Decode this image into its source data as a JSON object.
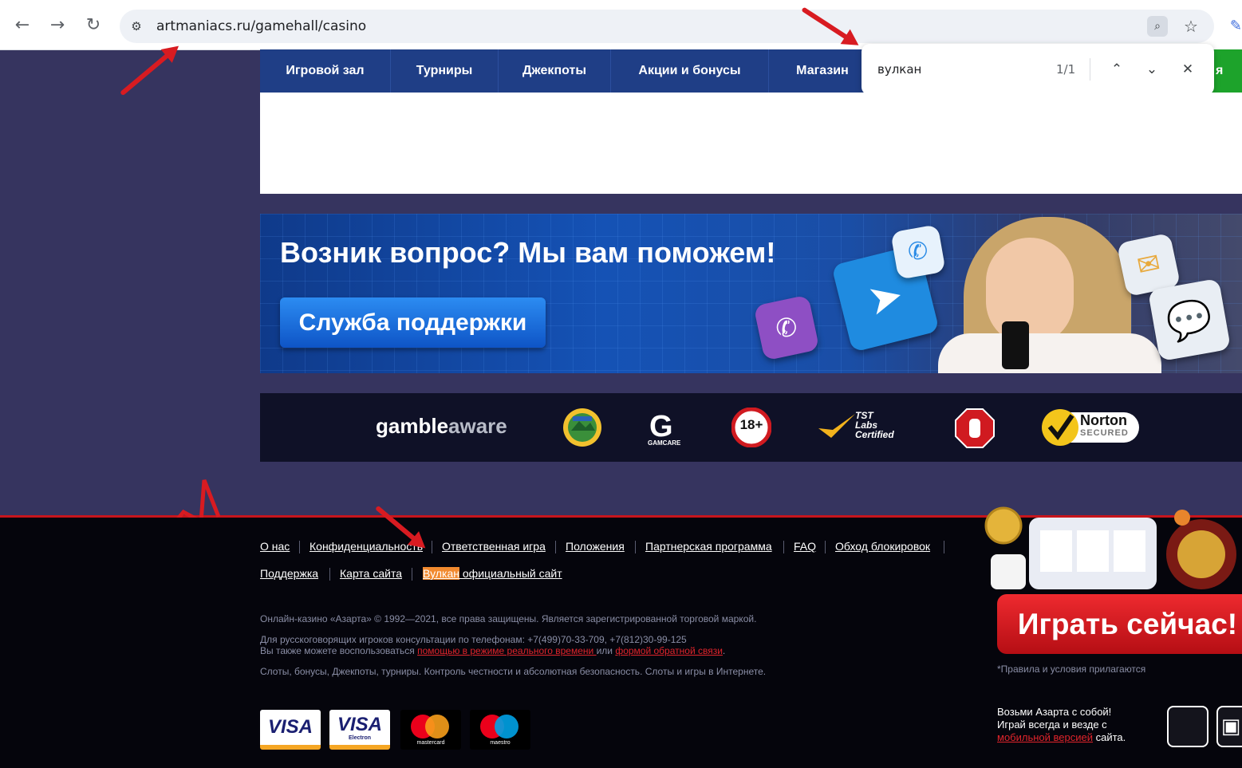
{
  "browser": {
    "url": "artmaniacs.ru/gamehall/casino",
    "back_icon": "arrow-left-icon",
    "forward_icon": "arrow-right-icon",
    "reload_icon": "reload-icon",
    "back_glyph": "←",
    "forward_glyph": "→",
    "reload_glyph": "↻",
    "star_glyph": "☆"
  },
  "find_bar": {
    "query": "вулкан",
    "count": "1/1",
    "prev_glyph": "⌃",
    "next_glyph": "⌄",
    "close_glyph": "✕"
  },
  "nav": {
    "items": [
      "Игровой зал",
      "Турниры",
      "Джекпоты",
      "Акции и бонусы",
      "Магазин"
    ],
    "green_partial": "я"
  },
  "support": {
    "title": "Возник вопрос? Мы вам поможем!",
    "button": "Служба поддержки"
  },
  "trust": {
    "gamble": "gamble",
    "aware": "aware",
    "gamcare": "GAMCARE",
    "age": "18+",
    "tst_line1": "TST",
    "tst_line2": "Labs",
    "tst_line3": "Certified",
    "norton_line1": "Norton",
    "norton_line2": "SECURED"
  },
  "footer": {
    "links_row1": [
      "О нас",
      "Конфиденциальность",
      "Ответственная игра",
      "Положения",
      "Партнерская программа",
      "FAQ",
      "Обход блокировок"
    ],
    "links_row2_a": "Поддержка",
    "links_row2_b": "Карта сайта",
    "links_row2_c_highlight": "Вулкан",
    "links_row2_c_rest": " официальный сайт",
    "copyright": "Онлайн-казино «Азарта» © 1992—2021, все права защищены. Является зарегистрированной торговой маркой.",
    "phones": "Для русскоговорящих игроков консультации по телефонам: +7(499)70-33-709, +7(812)30-99-125",
    "help_prefix": "Вы также можете воспользоваться ",
    "help_link": "помощью в режиме реального времени ",
    "help_or": "или ",
    "help_link2": "формой обратной связи",
    "help_end": ".",
    "slogan": "Слоты, бонусы, Джекпоты, турниры. Контроль честности и абсолютная безопасность. Слоты и игры в Интернете.",
    "cards": [
      "VISA",
      "VISA",
      "mastercard",
      "maestro"
    ],
    "visa_electron": "Electron"
  },
  "play": {
    "button": "Играть сейчас!",
    "rules": "*Правила и условия прилагаются",
    "mob_line1": "Возьми Азарта с собой!",
    "mob_line2": "Играй всегда и везде с",
    "mob_link": "мобильной версией",
    "mob_end": " сайта.",
    "apple_glyph": "",
    "android_glyph": "▣"
  },
  "colors": {
    "page_bg": "#36345f",
    "nav_blue": "#1f3e86",
    "accent_red": "#d81b21",
    "highlight": "#f28a2f"
  }
}
